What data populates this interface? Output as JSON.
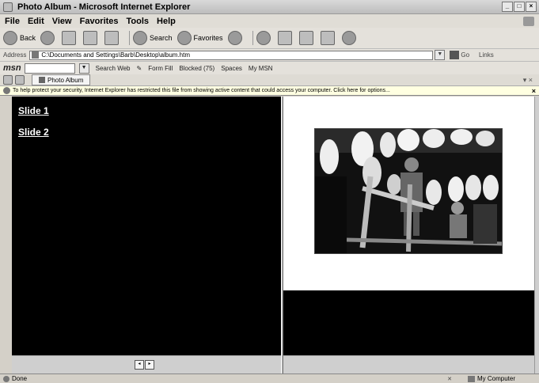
{
  "window": {
    "title": "Photo Album - Microsoft Internet Explorer",
    "buttons": [
      "_",
      "□",
      "×"
    ]
  },
  "menu": [
    "File",
    "Edit",
    "View",
    "Favorites",
    "Tools",
    "Help"
  ],
  "toolbar": {
    "back_label": "Back",
    "search_label": "Search",
    "favorites_label": "Favorites"
  },
  "address": {
    "label": "Address",
    "value": "C:\\Documents and Settings\\Barb\\Desktop\\album.htm",
    "go_label": "Go",
    "links_label": "Links"
  },
  "msn": {
    "logo": "msn",
    "search_web": "Search Web",
    "form_fill": "Form Fill",
    "blocked": "Blocked (75)",
    "spaces": "Spaces",
    "my_msn": "My MSN"
  },
  "tab": {
    "label": "Photo Album"
  },
  "infobar": {
    "text": "To help protect your security, Internet Explorer has restricted this file from showing active content that could access your computer. Click here for options...",
    "close": "×"
  },
  "slides": [
    {
      "label": "Slide 1"
    },
    {
      "label": "Slide 2"
    }
  ],
  "status": {
    "text": "Done",
    "zone": "My Computer"
  },
  "colors": {
    "frame_bg": "#000000",
    "link": "#ffffff",
    "infobar_bg": "#ffffe1",
    "chrome": "#d4d0c8"
  }
}
